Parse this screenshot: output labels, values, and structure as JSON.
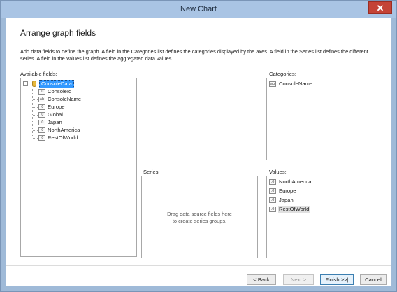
{
  "window": {
    "title": "New Chart",
    "close_glyph": "✕"
  },
  "page": {
    "heading": "Arrange graph fields",
    "description": "Add data fields to define the graph. A field in the Categories list defines the categories displayed by the axes. A field in the Series list defines the different series. A field in the Values list defines the aggregated data values."
  },
  "available": {
    "label": "Available fields:",
    "root": {
      "expander": "−",
      "label": "ConsoleData",
      "icon": "database-icon"
    },
    "fields": [
      {
        "label": "ConsoleId",
        "type": ".0"
      },
      {
        "label": "ConsoleName",
        "type": "ab"
      },
      {
        "label": "Europe",
        "type": ".0"
      },
      {
        "label": "Global",
        "type": ".0"
      },
      {
        "label": "Japan",
        "type": ".0"
      },
      {
        "label": "NorthAmerica",
        "type": ".0"
      },
      {
        "label": "RestOfWorld",
        "type": ".0"
      }
    ]
  },
  "categories": {
    "label": "Categories:",
    "items": [
      {
        "label": "ConsoleName",
        "type": "ab"
      }
    ]
  },
  "series": {
    "label": "Series:",
    "placeholder_line1": "Drag data source fields here",
    "placeholder_line2": "to create series groups."
  },
  "values": {
    "label": "Values:",
    "items": [
      {
        "label": "NorthAmerica",
        "type": ".0"
      },
      {
        "label": "Europe",
        "type": ".0"
      },
      {
        "label": "Japan",
        "type": ".0"
      },
      {
        "label": "RestOfWorld",
        "type": ".0"
      }
    ]
  },
  "buttons": {
    "back": "< Back",
    "next": "Next >",
    "finish": "Finish >>|",
    "cancel": "Cancel"
  }
}
